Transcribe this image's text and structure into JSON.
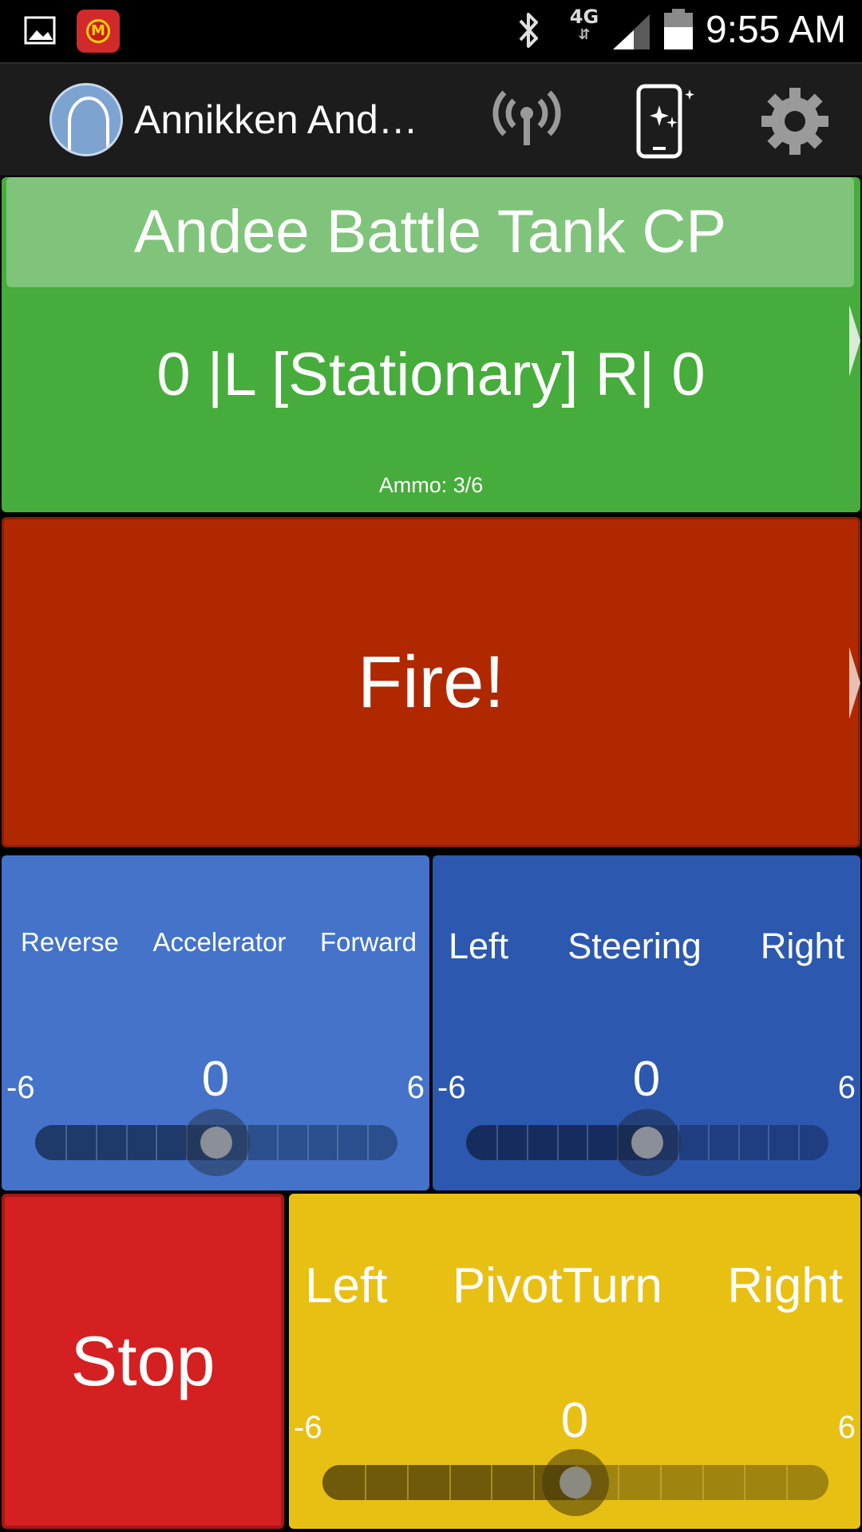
{
  "status_bar": {
    "network": "4G",
    "time": "9:55 AM",
    "icons": [
      "gallery-icon",
      "mcdonalds-alarm-icon",
      "bluetooth-icon",
      "network-4g-icon",
      "signal-icon",
      "battery-icon"
    ]
  },
  "action_bar": {
    "account_name": "Annikken And…",
    "icons": [
      "avatar-icon",
      "wireless-icon",
      "phone-sparkle-icon",
      "gear-icon"
    ]
  },
  "title_panel": {
    "title": "Andee Battle Tank CP",
    "status_line": "0 |L [Stationary] R| 0",
    "ammo": "Ammo: 3/6"
  },
  "fire_button": {
    "label": "Fire!"
  },
  "accelerator": {
    "label_left": "Reverse",
    "label_center": "Accelerator",
    "label_right": "Forward",
    "value": "0",
    "min": "-6",
    "max": "6",
    "level": 0.5
  },
  "steering": {
    "label_left": "Left",
    "label_center": "Steering",
    "label_right": "Right",
    "value": "0",
    "min": "-6",
    "max": "6",
    "level": 0.5
  },
  "stop_button": {
    "label": "Stop"
  },
  "pivot_turn": {
    "label_left": "Left",
    "label_center": "PivotTurn",
    "label_right": "Right",
    "value": "0",
    "min": "-6",
    "max": "6",
    "level": 0.5
  },
  "colors": {
    "title_panel": "#46ac3c",
    "fire": "#b02800",
    "accelerator": "#4473c9",
    "steering": "#2d58b0",
    "stop": "#d42020",
    "pivot": "#e8c014"
  }
}
